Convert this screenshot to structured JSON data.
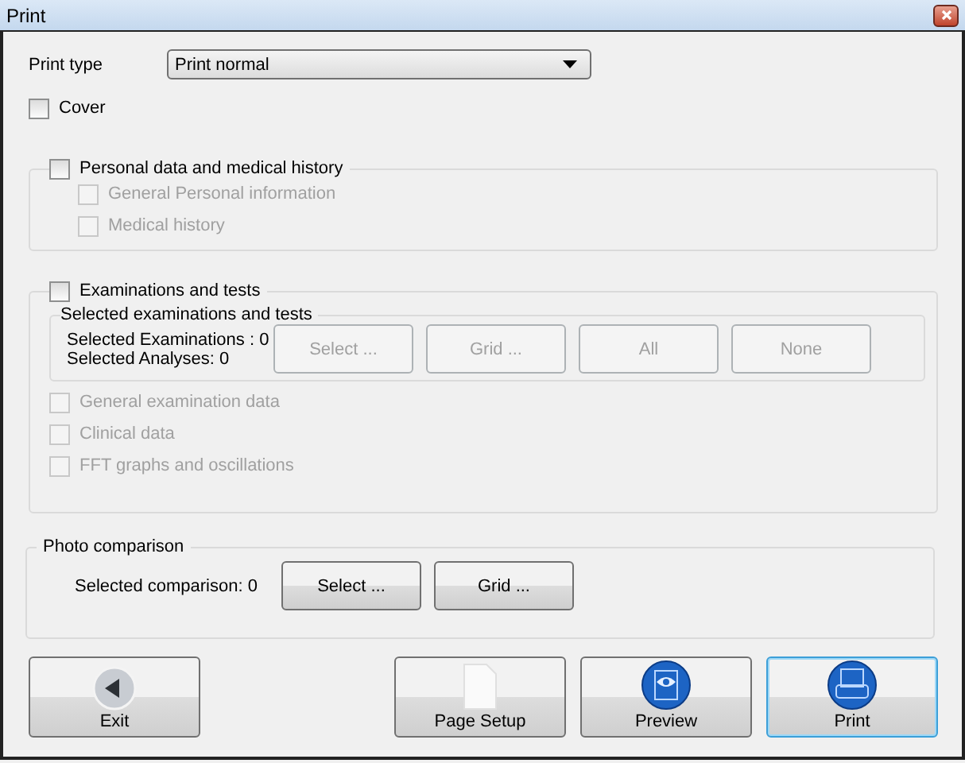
{
  "window": {
    "title": "Print"
  },
  "print_type": {
    "label": "Print type",
    "value": "Print normal"
  },
  "cover": {
    "label": "Cover",
    "checked": false
  },
  "personal": {
    "label": "Personal data and medical history",
    "checked": false,
    "items": [
      {
        "label": "General Personal information",
        "checked": false,
        "disabled": true
      },
      {
        "label": "Medical history",
        "checked": false,
        "disabled": true
      }
    ]
  },
  "exams": {
    "label": "Examinations and tests",
    "checked": false,
    "selection": {
      "title": "Selected examinations and tests",
      "lines": [
        "Selected Examinations : 0",
        "Selected Analyses: 0"
      ],
      "buttons": [
        {
          "label": "Select ...",
          "disabled": true
        },
        {
          "label": "Grid ...",
          "disabled": true
        },
        {
          "label": "All",
          "disabled": true
        },
        {
          "label": "None",
          "disabled": true
        }
      ]
    },
    "items": [
      {
        "label": "General examination data",
        "checked": false,
        "disabled": true
      },
      {
        "label": "Clinical data",
        "checked": false,
        "disabled": true
      },
      {
        "label": "FFT graphs and oscillations",
        "checked": false,
        "disabled": true
      }
    ]
  },
  "photo": {
    "title": "Photo comparison",
    "label": "Selected comparison: 0",
    "buttons": [
      {
        "label": "Select ...",
        "disabled": false
      },
      {
        "label": "Grid ...",
        "disabled": false
      }
    ]
  },
  "footer": [
    {
      "label": "Exit",
      "kind": "exit",
      "focused": false
    },
    {
      "label": "Page Setup",
      "kind": "page",
      "focused": false
    },
    {
      "label": "Preview",
      "kind": "preview",
      "focused": false
    },
    {
      "label": "Print",
      "kind": "print",
      "focused": true
    }
  ]
}
